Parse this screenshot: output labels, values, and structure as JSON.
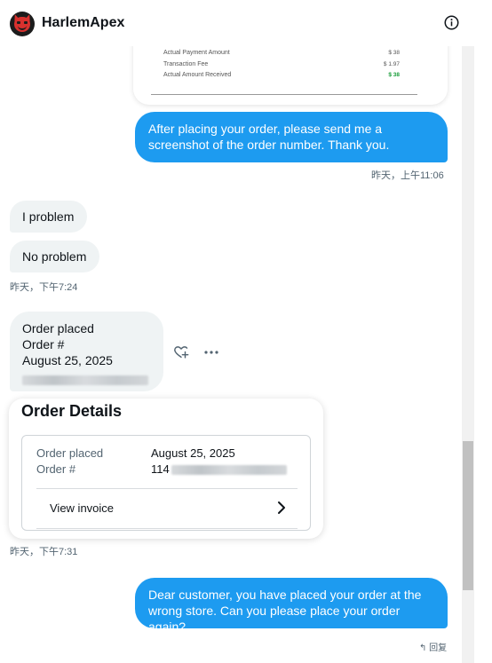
{
  "header": {
    "title": "HarlemApex",
    "avatar_icon": "devil-emoji-icon",
    "info_icon": "info-icon"
  },
  "receipt": {
    "rows": [
      {
        "label": "Actual Payment Amount",
        "value": "$ 38"
      },
      {
        "label": "Transaction Fee",
        "value": "$ 1.97"
      },
      {
        "label": "Actual Amount Received",
        "value": "$ 38"
      }
    ],
    "received_color": "#1a9d3a"
  },
  "messages": {
    "m1": "After placing your order, please send me a screenshot of the order number. Thank you.",
    "t1": "昨天，上午11:06",
    "m2": "I problem",
    "m3": "No problem",
    "t2": "昨天，下午7:24",
    "m4_line1": "Order placed",
    "m4_line2": "Order #",
    "m4_line3": "August 25, 2025",
    "m5": "Dear customer, you have placed your order at the wrong store. Can you please place your order again?",
    "t3": "昨天，下午7:31"
  },
  "order_card": {
    "title": "Order Details",
    "placed_label": "Order placed",
    "placed_value": "August 25, 2025",
    "number_label": "Order #",
    "number_prefix": "114",
    "view_invoice": "View invoice"
  },
  "actions": {
    "react_icon": "heart-plus-icon",
    "more_icon": "more-horizontal-icon",
    "reply_label": "回复"
  },
  "colors": {
    "accent": "#1d9bf0",
    "bubble_them": "#eff3f4",
    "timestamp": "#536471"
  }
}
